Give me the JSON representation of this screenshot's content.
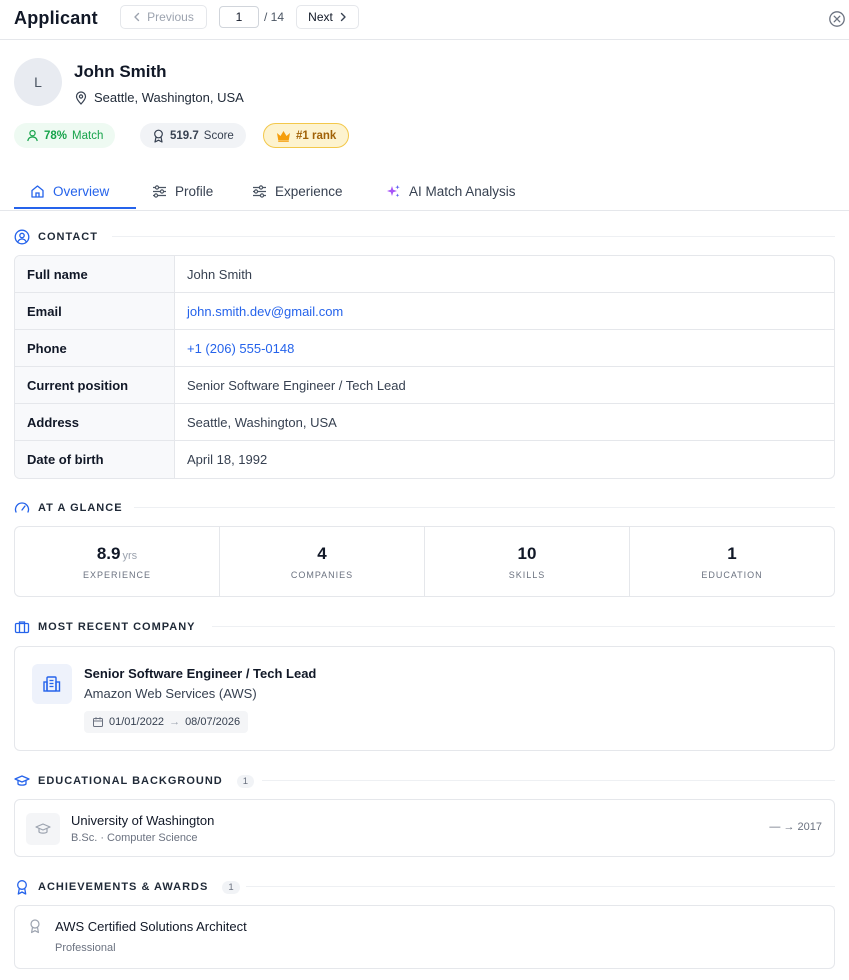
{
  "header": {
    "title": "Applicant",
    "prev_label": "Previous",
    "page_current": "1",
    "page_total": "/ 14",
    "next_label": "Next"
  },
  "applicant": {
    "initial": "L",
    "name": "John Smith",
    "location": "Seattle, Washington, USA"
  },
  "badges": {
    "match_value": "78%",
    "match_label": "Match",
    "score_value": "519.7",
    "score_label": "Score",
    "rank_label": "#1 rank"
  },
  "tabs": [
    {
      "label": "Overview",
      "icon": "home-icon",
      "active": true
    },
    {
      "label": "Profile",
      "icon": "sliders-icon",
      "active": false
    },
    {
      "label": "Experience",
      "icon": "sliders-icon",
      "active": false
    },
    {
      "label": "AI Match Analysis",
      "icon": "sparkles-icon",
      "active": false
    }
  ],
  "contact": {
    "section_title": "CONTACT",
    "rows": [
      {
        "key": "Full name",
        "value": "John Smith"
      },
      {
        "key": "Email",
        "value": "john.smith.dev@gmail.com"
      },
      {
        "key": "Phone",
        "value": "+1 (206) 555-0148"
      },
      {
        "key": "Current position",
        "value": "Senior Software Engineer / Tech Lead"
      },
      {
        "key": "Address",
        "value": "Seattle, Washington, USA"
      },
      {
        "key": "Date of birth",
        "value": "April 18, 1992"
      }
    ]
  },
  "glance": {
    "section_title": "AT A GLANCE",
    "experience_value": "8.9",
    "experience_unit": "yrs",
    "experience_label": "EXPERIENCE",
    "companies_value": "4",
    "companies_label": "COMPANIES",
    "skills_value": "10",
    "skills_label": "SKILLS",
    "education_value": "1",
    "education_label": "EDUCATION"
  },
  "recent_company": {
    "section_title": "MOST RECENT COMPANY",
    "title": "Senior Software Engineer / Tech Lead",
    "company": "Amazon Web Services (AWS)",
    "start": "01/01/2022",
    "arrow": "→",
    "end": "08/07/2026"
  },
  "education": {
    "section_title": "EDUCATIONAL BACKGROUND",
    "count": "1",
    "school": "University of Washington",
    "degree": "B.Sc. · Computer Science",
    "dates": "— → 2017"
  },
  "achievements": {
    "section_title": "ACHIEVEMENTS & AWARDS",
    "count": "1",
    "title": "AWS Certified Solutions Architect",
    "level": "Professional"
  },
  "colors": {
    "accent": "#2563eb",
    "match_green": "#16a34a",
    "rank_gold": "#f3c84b"
  }
}
